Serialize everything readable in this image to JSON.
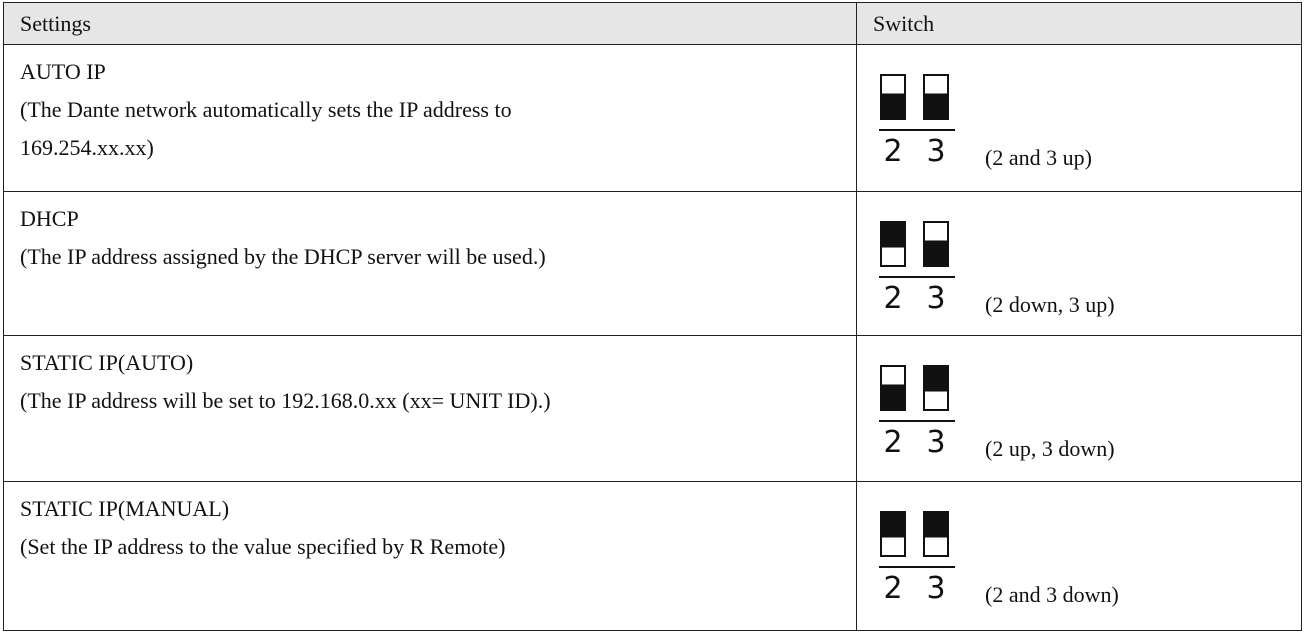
{
  "table": {
    "header": {
      "settings": "Settings",
      "switch": "Switch"
    },
    "rows": [
      {
        "title": "AUTO IP",
        "description_lines": [
          "(The Dante network automatically sets the IP address to",
          "169.254.xx.xx)"
        ],
        "switch_2": "up",
        "switch_3": "up",
        "caption": "(2 and 3 up)"
      },
      {
        "title": "DHCP",
        "description_lines": [
          "(The IP address assigned by the DHCP server will be used.)"
        ],
        "switch_2": "down",
        "switch_3": "up",
        "caption": "(2 down, 3 up)"
      },
      {
        "title": "STATIC IP(AUTO)",
        "description_lines": [
          "(The IP address will be set to 192.168.0.xx (xx= UNIT ID).)"
        ],
        "switch_2": "up",
        "switch_3": "down",
        "caption": "(2 up, 3 down)"
      },
      {
        "title": "STATIC IP(MANUAL)",
        "description_lines": [
          "(Set the IP address to the value specified by R Remote)"
        ],
        "switch_2": "down",
        "switch_3": "down",
        "caption": "(2 and 3 down)"
      }
    ],
    "switch_labels": [
      "2",
      "3"
    ]
  }
}
